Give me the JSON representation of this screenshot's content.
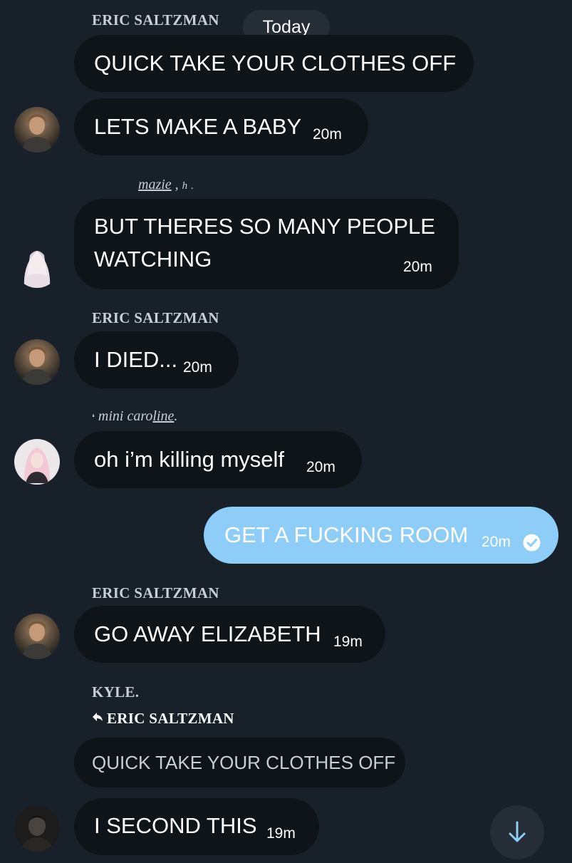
{
  "date_separator": "Today",
  "messages": [
    {
      "sender": "ERIC SALTZMAN",
      "text": "QUICK TAKE YOUR CLOTHES OFF",
      "time": ""
    },
    {
      "sender": "",
      "text": "LETS MAKE A BABY",
      "time": "20m"
    },
    {
      "sender_parts": {
        "a": "mazie",
        "b": ",",
        "c": "h",
        "d": "."
      },
      "text_line1": "BUT THERES SO MANY PEOPLE",
      "text_line2": "WATCHING",
      "time": "20m"
    },
    {
      "sender": "ERIC SALTZMAN",
      "text": "I DIED...",
      "time": "20m"
    },
    {
      "sender_parts": {
        "a": "mini",
        "b": "caro",
        "c": "line",
        "d": "."
      },
      "text": "oh i’m killing myself",
      "time": "20m"
    },
    {
      "own": true,
      "text": "GET A FUCKING ROOM",
      "time": "20m"
    },
    {
      "sender": "ERIC SALTZMAN",
      "text": "GO AWAY ELIZABETH",
      "time": "19m"
    },
    {
      "sender": "KYLE.",
      "reply_to": "ERIC SALTZMAN",
      "quoted": "QUICK TAKE YOUR CLOTHES OFF",
      "text": "I SECOND THIS",
      "time": "19m"
    }
  ],
  "colors": {
    "background": "#182029",
    "bubble": "#0f1419",
    "own_bubble": "#8ecdf8",
    "name": "#c7ced8"
  },
  "icons": {
    "scroll_down": "arrow-down-icon",
    "read_receipt": "check-circle-icon",
    "reply": "reply-icon"
  }
}
